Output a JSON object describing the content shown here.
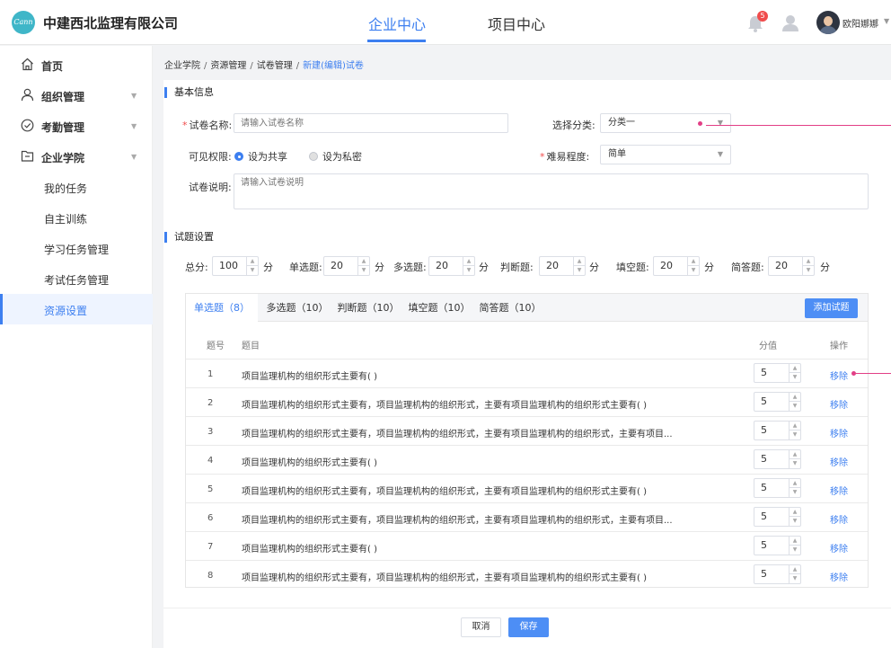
{
  "header": {
    "logo_text": "Cann",
    "company": "中建西北监理有限公司",
    "tabs": [
      {
        "label": "企业中心",
        "active": true
      },
      {
        "label": "项目中心",
        "active": false
      }
    ],
    "notification_count": "5",
    "username": "欧阳娜娜"
  },
  "sidebar": {
    "items": [
      {
        "label": "首页",
        "icon": "home-icon"
      },
      {
        "label": "组织管理",
        "icon": "user-icon"
      },
      {
        "label": "考勤管理",
        "icon": "check-circle-icon"
      },
      {
        "label": "企业学院",
        "icon": "folder-icon"
      }
    ],
    "sub_items": [
      {
        "label": "我的任务"
      },
      {
        "label": "自主训练"
      },
      {
        "label": "学习任务管理"
      },
      {
        "label": "考试任务管理"
      },
      {
        "label": "资源设置",
        "active": true
      }
    ]
  },
  "breadcrumb": [
    "企业学院",
    "资源管理",
    "试卷管理",
    "新建(编辑)试卷"
  ],
  "basic": {
    "section_title": "基本信息",
    "name_label": "试卷名称:",
    "name_placeholder": "请输入试卷名称",
    "category_label": "选择分类:",
    "category_value": "分类一",
    "visibility_label": "可见权限:",
    "visibility_options": [
      "设为共享",
      "设为私密"
    ],
    "difficulty_label": "难易程度:",
    "difficulty_value": "简单",
    "desc_label": "试卷说明:",
    "desc_placeholder": "请输入试卷说明"
  },
  "settings": {
    "section_title": "试题设置",
    "unit": "分",
    "fields": [
      {
        "label": "总分:",
        "value": "100"
      },
      {
        "label": "单选题:",
        "value": "20"
      },
      {
        "label": "多选题:",
        "value": "20"
      },
      {
        "label": "判断题:",
        "value": "20"
      },
      {
        "label": "填空题:",
        "value": "20"
      },
      {
        "label": "简答题:",
        "value": "20"
      }
    ]
  },
  "question_tabs": [
    "单选题（8）",
    "多选题（10）",
    "判断题（10）",
    "填空题（10）",
    "简答题（10）"
  ],
  "add_button": "添加试题",
  "table": {
    "headers": {
      "index": "题号",
      "question": "题目",
      "score": "分值",
      "action": "操作"
    },
    "rows": [
      {
        "index": "1",
        "question": "项目监理机构的组织形式主要有(    )",
        "score": "5",
        "action": "移除"
      },
      {
        "index": "2",
        "question": "项目监理机构的组织形式主要有，项目监理机构的组织形式，主要有项目监理机构的组织形式主要有(    )",
        "score": "5",
        "action": "移除"
      },
      {
        "index": "3",
        "question": "项目监理机构的组织形式主要有，项目监理机构的组织形式，主要有项目监理机构的组织形式，主要有项目...",
        "score": "5",
        "action": "移除"
      },
      {
        "index": "4",
        "question": "项目监理机构的组织形式主要有(    )",
        "score": "5",
        "action": "移除"
      },
      {
        "index": "5",
        "question": "项目监理机构的组织形式主要有，项目监理机构的组织形式，主要有项目监理机构的组织形式主要有(    )",
        "score": "5",
        "action": "移除"
      },
      {
        "index": "6",
        "question": "项目监理机构的组织形式主要有，项目监理机构的组织形式，主要有项目监理机构的组织形式，主要有项目...",
        "score": "5",
        "action": "移除"
      },
      {
        "index": "7",
        "question": "项目监理机构的组织形式主要有(    )",
        "score": "5",
        "action": "移除"
      },
      {
        "index": "8",
        "question": "项目监理机构的组织形式主要有，项目监理机构的组织形式，主要有项目监理机构的组织形式主要有(    )",
        "score": "5",
        "action": "移除"
      }
    ]
  },
  "footer": {
    "cancel": "取消",
    "save": "保存"
  }
}
